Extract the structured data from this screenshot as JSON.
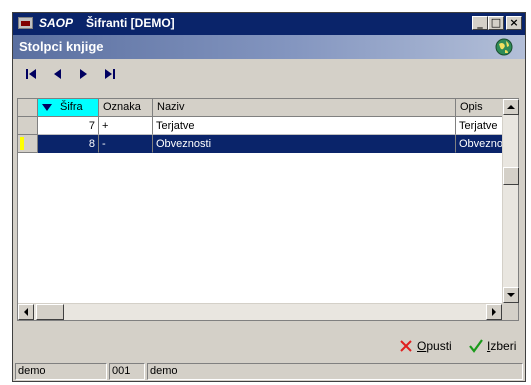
{
  "window": {
    "brand": "SAOP",
    "title": "Šifranti [DEMO]",
    "minimize_glyph": "_",
    "maximize_glyph": "□",
    "close_glyph": "×"
  },
  "header": {
    "title": "Stolpci knjige",
    "icon": "globe-icon"
  },
  "navigation": {
    "buttons": [
      "first-record-icon",
      "previous-record-icon",
      "next-record-icon",
      "last-record-icon"
    ]
  },
  "grid": {
    "columns": [
      {
        "label": "Šifra",
        "sorted": true
      },
      {
        "label": "Oznaka"
      },
      {
        "label": "Naziv"
      },
      {
        "label": "Opis"
      }
    ],
    "rows": [
      {
        "sifra": "7",
        "oznaka": "+",
        "naziv": "Terjatve",
        "opis": "Terjatve",
        "selected": false
      },
      {
        "sifra": "8",
        "oznaka": "-",
        "naziv": "Obveznosti",
        "opis": "Obveznosti",
        "selected": true
      }
    ]
  },
  "actions": {
    "cancel_prefix": "",
    "cancel_hotkey": "O",
    "cancel_rest": "pusti",
    "select_hotkey": "I",
    "select_rest": "zberi"
  },
  "statusbar": {
    "user": "demo",
    "code": "001",
    "company": "demo"
  },
  "colors": {
    "title_bar": "#0a246a",
    "selection": "#0a246a",
    "sorted_header": "#00ffff",
    "cancel_red": "#e02020",
    "confirm_green": "#1a9a1a"
  }
}
